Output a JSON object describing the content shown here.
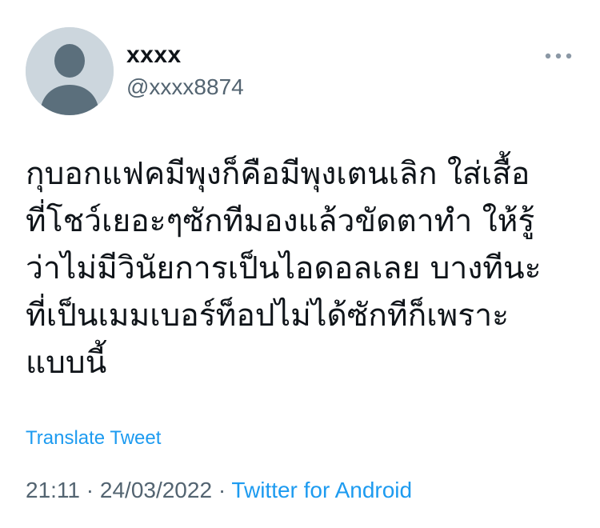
{
  "author": {
    "display_name": "xxxx",
    "handle": "@xxxx8874",
    "avatar_icon": "default-avatar-icon"
  },
  "more_icon": "more-horizontal-icon",
  "tweet": {
    "text": "กุบอกแฟคมีพุงก็คือมีพุงเตนเลิก ใส่เสื้อ\nที่โชว์เยอะๆซักทีมองแล้วขัดตาทำ ให้รู้\nว่าไม่มีวินัยการเป็นไอดอลเลย บางทีนะ\nที่เป็นเมมเบอร์ท็อปไม่ได้ซักทีก็เพราะ\nแบบนี้",
    "translate_label": "Translate Tweet",
    "time": "21:11",
    "separator": "·",
    "date": "24/03/2022",
    "source": "Twitter for Android"
  },
  "colors": {
    "link": "#1d9bf0",
    "secondary_text": "#536471",
    "avatar_bg": "#ccd6dd",
    "avatar_fg": "#5b6f7c"
  }
}
